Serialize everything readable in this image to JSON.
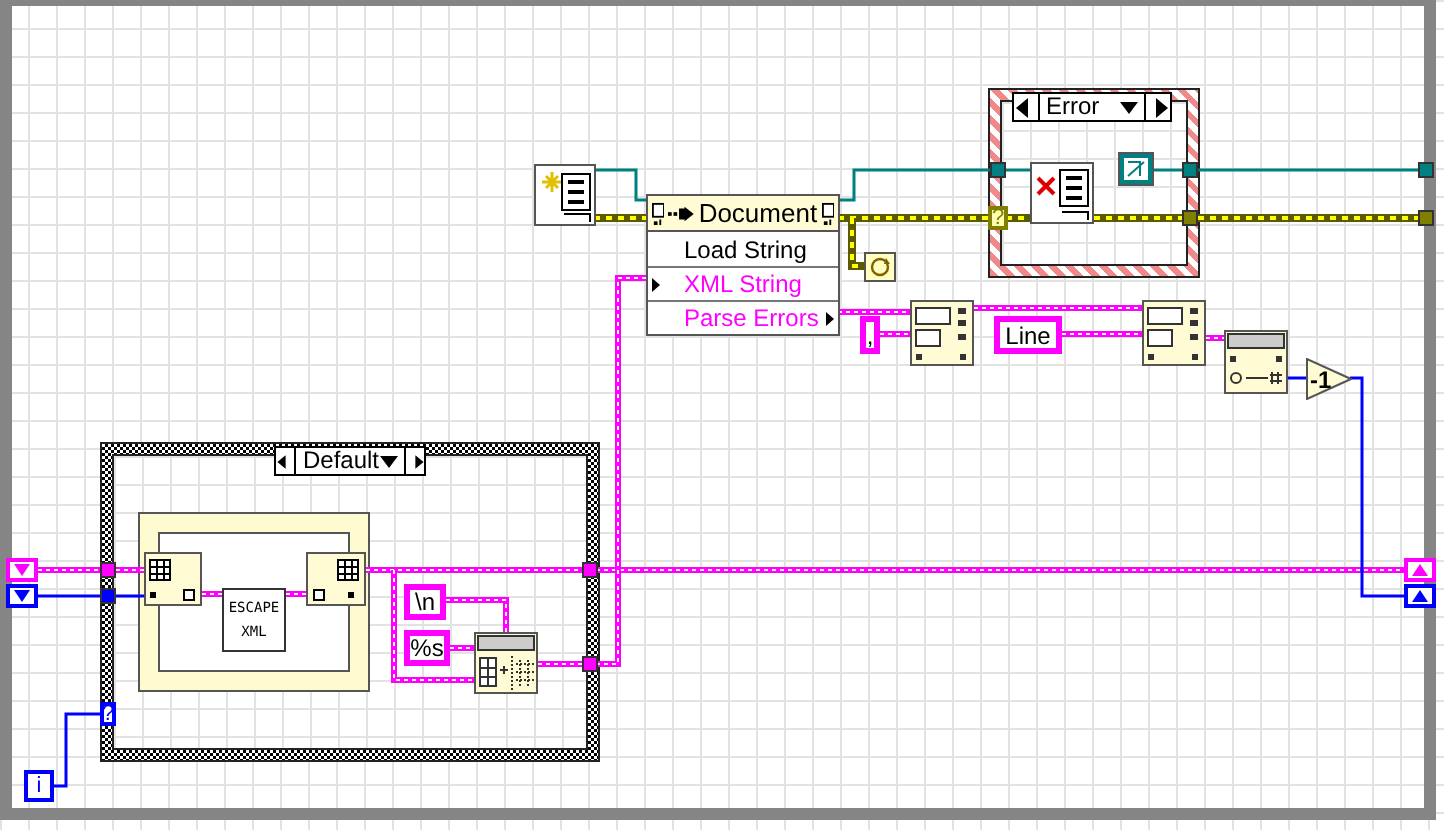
{
  "diagram": {
    "property_node": {
      "title": "Document",
      "properties": [
        {
          "label": "Load String",
          "kind": "method"
        },
        {
          "label": "XML String",
          "kind": "input"
        },
        {
          "label": "Parse Errors",
          "kind": "output"
        }
      ]
    },
    "error_case": {
      "selector": "Error",
      "tunnel_label": "?"
    },
    "default_case": {
      "selector": "Default",
      "subvi_label": "ESCAPE XML",
      "selector_terminal": "?"
    },
    "constants": [
      {
        "text": "\\n"
      },
      {
        "text": "%s"
      },
      {
        "text": ","
      },
      {
        "text": "Line"
      }
    ],
    "decrement_label": "-1",
    "iteration_terminal": "i"
  }
}
